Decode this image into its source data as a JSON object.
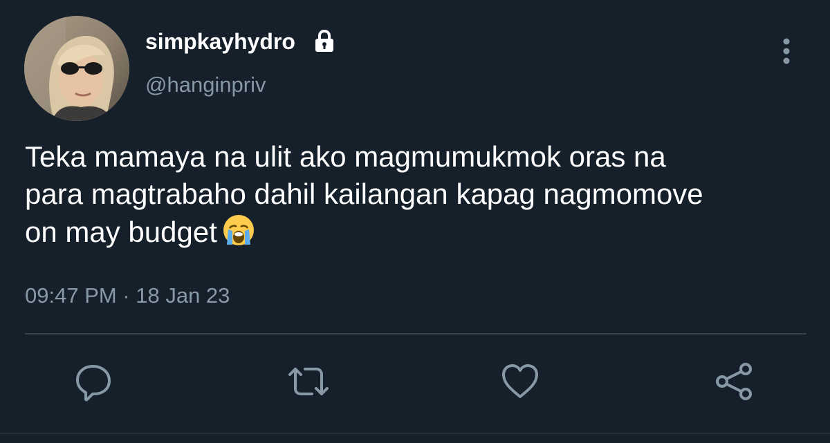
{
  "user": {
    "display_name": "simpkayhydro",
    "handle": "@hanginpriv",
    "avatar": "avatar-photo",
    "protected_icon": "lock-icon"
  },
  "tweet": {
    "text_lines": [
      "Teka mamaya na ulit ako magmumukmok oras na",
      "para magtrabaho dahil kailangan kapag nagmomove",
      "on may budget"
    ],
    "emoji": "loudly-crying-face",
    "timestamp": "09:47 PM · 18 Jan 23"
  },
  "actions": [
    {
      "name": "reply",
      "icon": "speech-bubble-icon"
    },
    {
      "name": "retweet",
      "icon": "retweet-icon"
    },
    {
      "name": "like",
      "icon": "heart-icon"
    },
    {
      "name": "share",
      "icon": "share-icon"
    }
  ],
  "menu_icon": "more-vertical-icon",
  "colors": {
    "background": "#15202b",
    "primary_text": "#ffffff",
    "secondary_text": "#8899a6",
    "divider": "#38444d"
  }
}
